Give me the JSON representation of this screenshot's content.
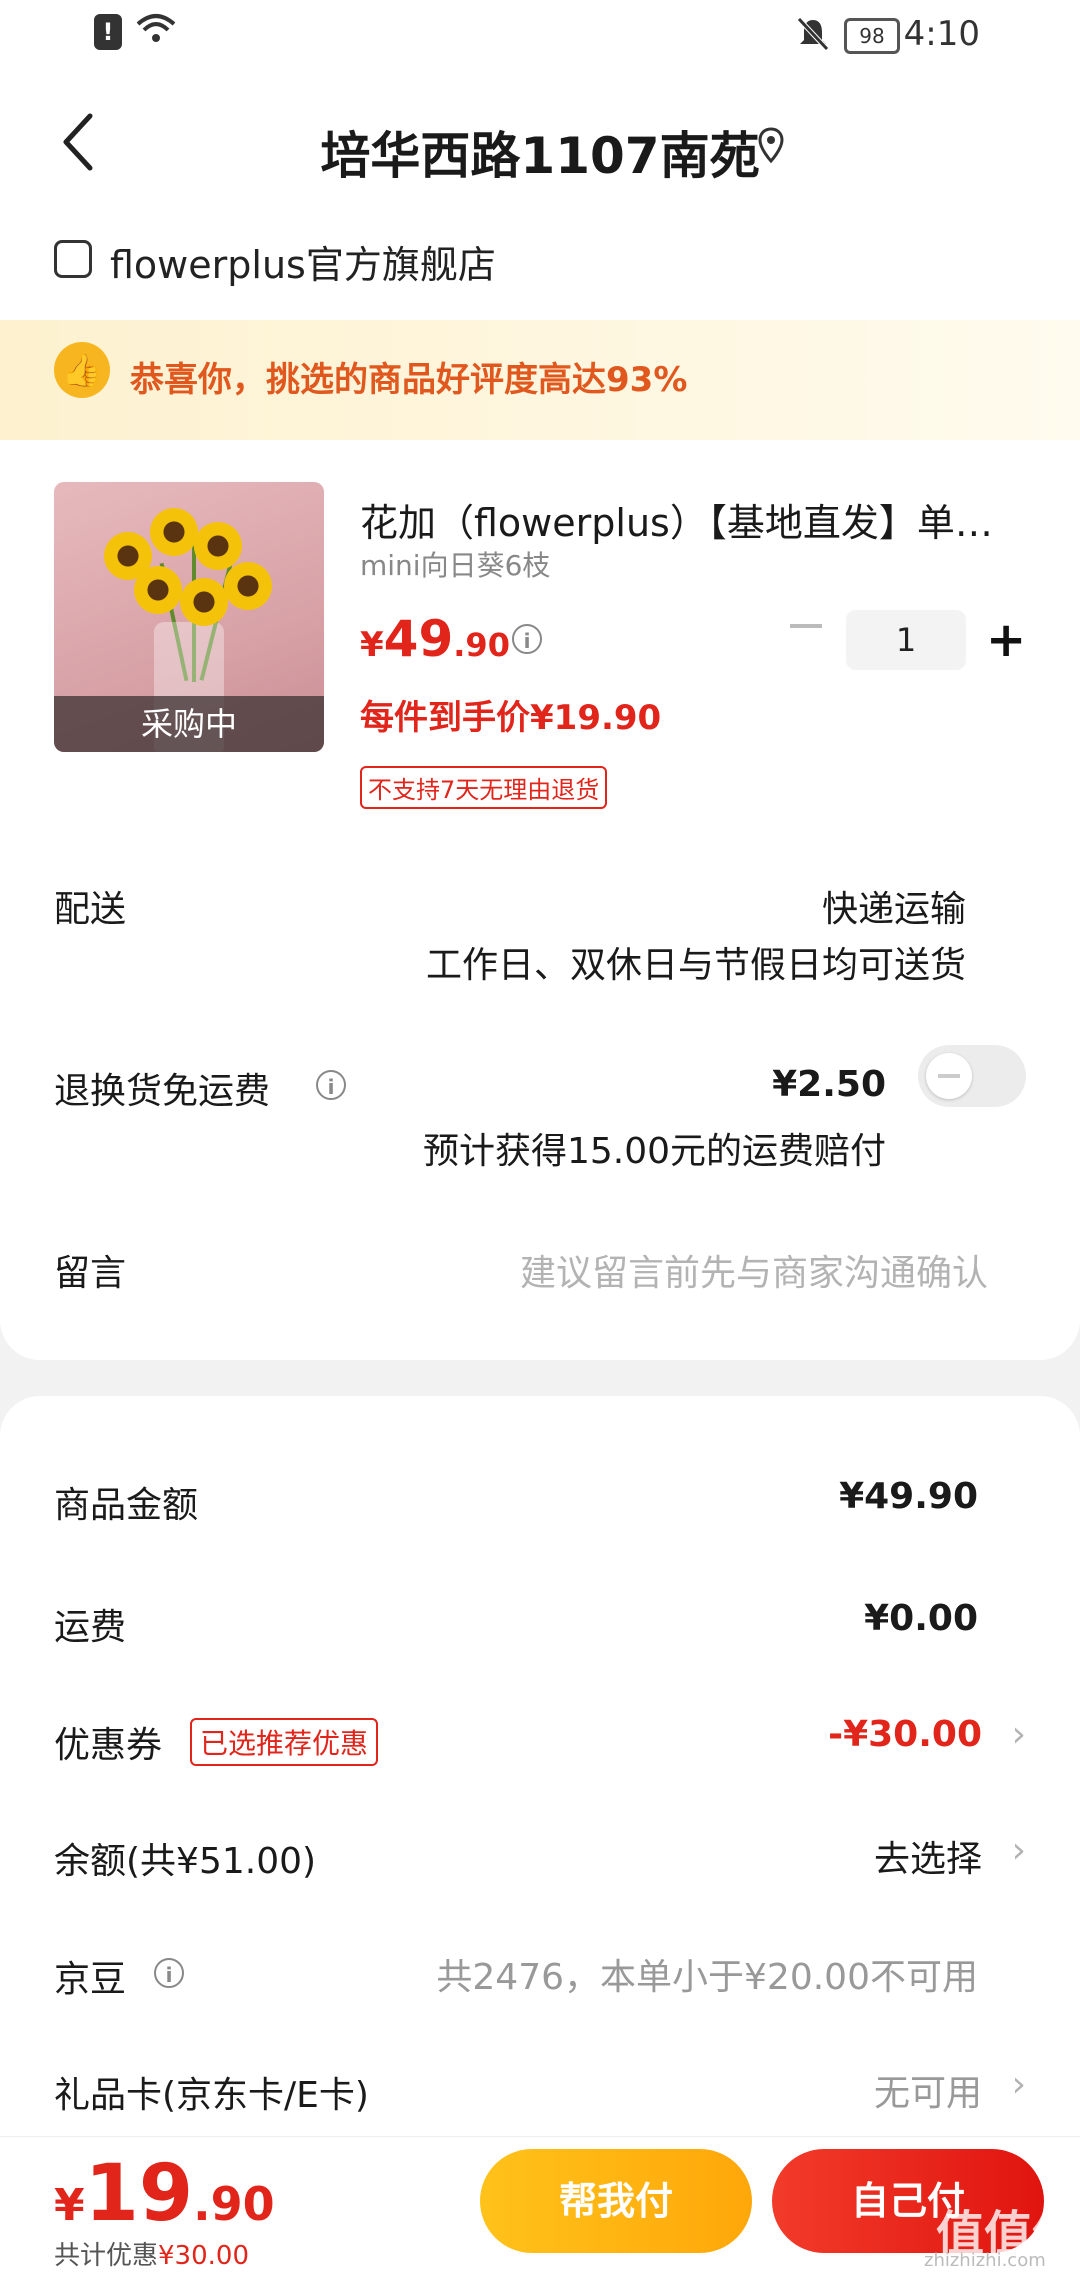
{
  "status_bar": {
    "battery": "98",
    "time": "4:10"
  },
  "header": {
    "title": "培华西路1107南苑"
  },
  "store": {
    "name": "flowerplus官方旗舰店"
  },
  "banner": {
    "text": "恭喜你，挑选的商品好评度高达93%"
  },
  "product": {
    "image_badge": "采购中",
    "name": "花加（flowerplus）【基地直发】单头向日葵鲜花",
    "spec": "mini向日葵6枝",
    "price_currency": "¥",
    "price_int": "49",
    "price_dec": ".90",
    "quantity": "1",
    "unit_price": "每件到手价¥19.90",
    "no_return_tag": "不支持7天无理由退货"
  },
  "delivery": {
    "label": "配送",
    "method": "快递运输",
    "schedule": "工作日、双休日与节假日均可送货"
  },
  "return_insurance": {
    "label": "退换货免运费",
    "price": "¥2.50",
    "note": "预计获得15.00元的运费赔付",
    "enabled": false
  },
  "message": {
    "label": "留言",
    "placeholder": "建议留言前先与商家沟通确认"
  },
  "summary": {
    "goods_label": "商品金额",
    "goods_value": "¥49.90",
    "shipping_label": "运费",
    "shipping_value": "¥0.00",
    "coupon_label": "优惠券",
    "coupon_tag": "已选推荐优惠",
    "coupon_value": "-¥30.00",
    "balance_label": "余额(共¥51.00)",
    "balance_value": "去选择",
    "jd_beans_label": "京豆",
    "jd_beans_value": "共2476，本单小于¥20.00不可用",
    "gift_card_label": "礼品卡(京东卡/E卡)",
    "gift_card_value": "无可用"
  },
  "bottom_bar": {
    "total_currency": "¥",
    "total_int": "19",
    "total_dec": ".90",
    "saved_prefix": "共计优惠",
    "saved_amount": "¥30.00",
    "help_pay_label": "帮我付",
    "self_pay_label": "自己付"
  },
  "watermark": {
    "text": "值值值",
    "sub": "zhizhizhi.com"
  },
  "colors": {
    "accent_red": "#e1251b",
    "accent_yellow": "#ffb914",
    "banner_text": "#e0581e"
  }
}
